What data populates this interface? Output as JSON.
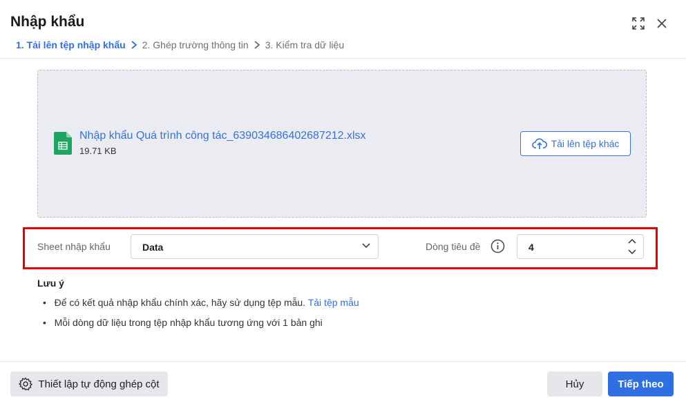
{
  "title": "Nhập khẩu",
  "steps": [
    "1. Tải lên tệp nhập khẩu",
    "2. Ghép trường thông tin",
    "3. Kiểm tra dữ liệu"
  ],
  "file": {
    "name": "Nhập khẩu Quá trình công tác_639034686402687212.xlsx",
    "size": "19.71 KB",
    "upload_other": "Tải lên tệp khác"
  },
  "sheet": {
    "label": "Sheet nhập khẩu",
    "value": "Data"
  },
  "header_row": {
    "label": "Dòng tiêu đề",
    "value": "4"
  },
  "notes": {
    "title": "Lưu ý",
    "item1": "Để có kết quả nhập khẩu chính xác, hãy sử dụng tệp mẫu.",
    "item1_link": "Tải tệp mẫu",
    "item2": "Mỗi dòng dữ liệu trong tệp nhập khẩu tương ứng với 1 bản ghi"
  },
  "footer": {
    "auto_map": "Thiết lập tự động ghép cột",
    "cancel": "Hủy",
    "next": "Tiếp theo"
  }
}
